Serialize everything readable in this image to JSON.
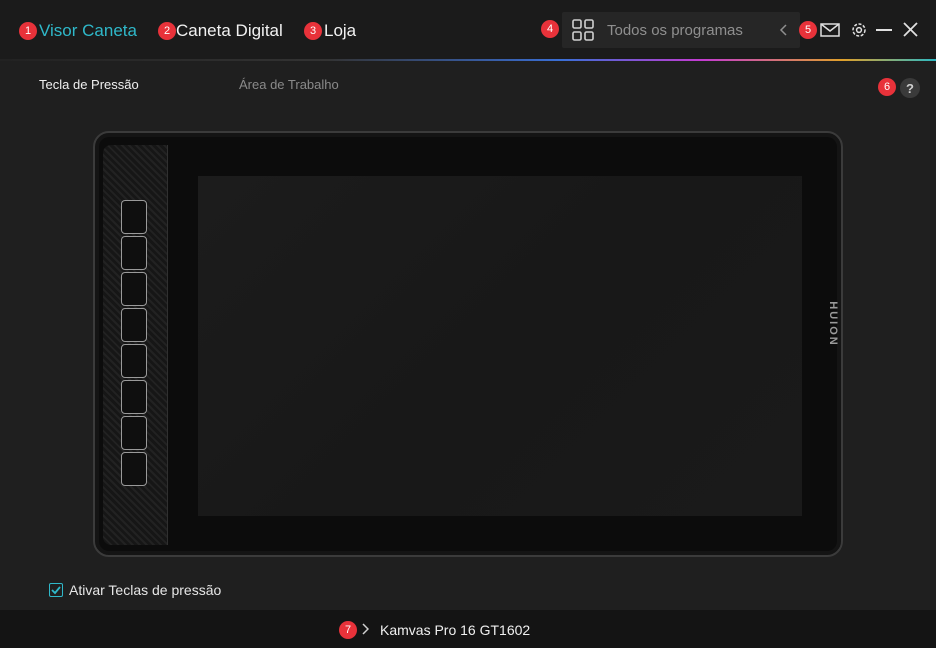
{
  "nav": {
    "items": [
      {
        "badge": "1",
        "label": "Visor Caneta",
        "active": true
      },
      {
        "badge": "2",
        "label": "Caneta Digital",
        "active": false
      },
      {
        "badge": "3",
        "label": "Loja",
        "active": false
      }
    ]
  },
  "search": {
    "badge": "4",
    "placeholder": "Todos os programas"
  },
  "window_controls": {
    "badge": "5",
    "icons": [
      "mail-icon",
      "gear-icon",
      "minimize-icon",
      "close-icon"
    ]
  },
  "subtabs": {
    "pressure_keys": "Tecla de Pressão",
    "work_area": "Área de Trabalho",
    "help_badge": "6",
    "help_label": "?"
  },
  "tablet": {
    "brand": "HUION",
    "express_keys": 8
  },
  "settings": {
    "enable_keys_label": "Ativar Teclas de pressão",
    "enable_keys_checked": true
  },
  "footer": {
    "badge": "7",
    "device_name": "Kamvas Pro 16 GT1602"
  },
  "colors": {
    "accent": "#2fb8c9",
    "badge": "#e8323a",
    "background": "#1f1f1f"
  }
}
